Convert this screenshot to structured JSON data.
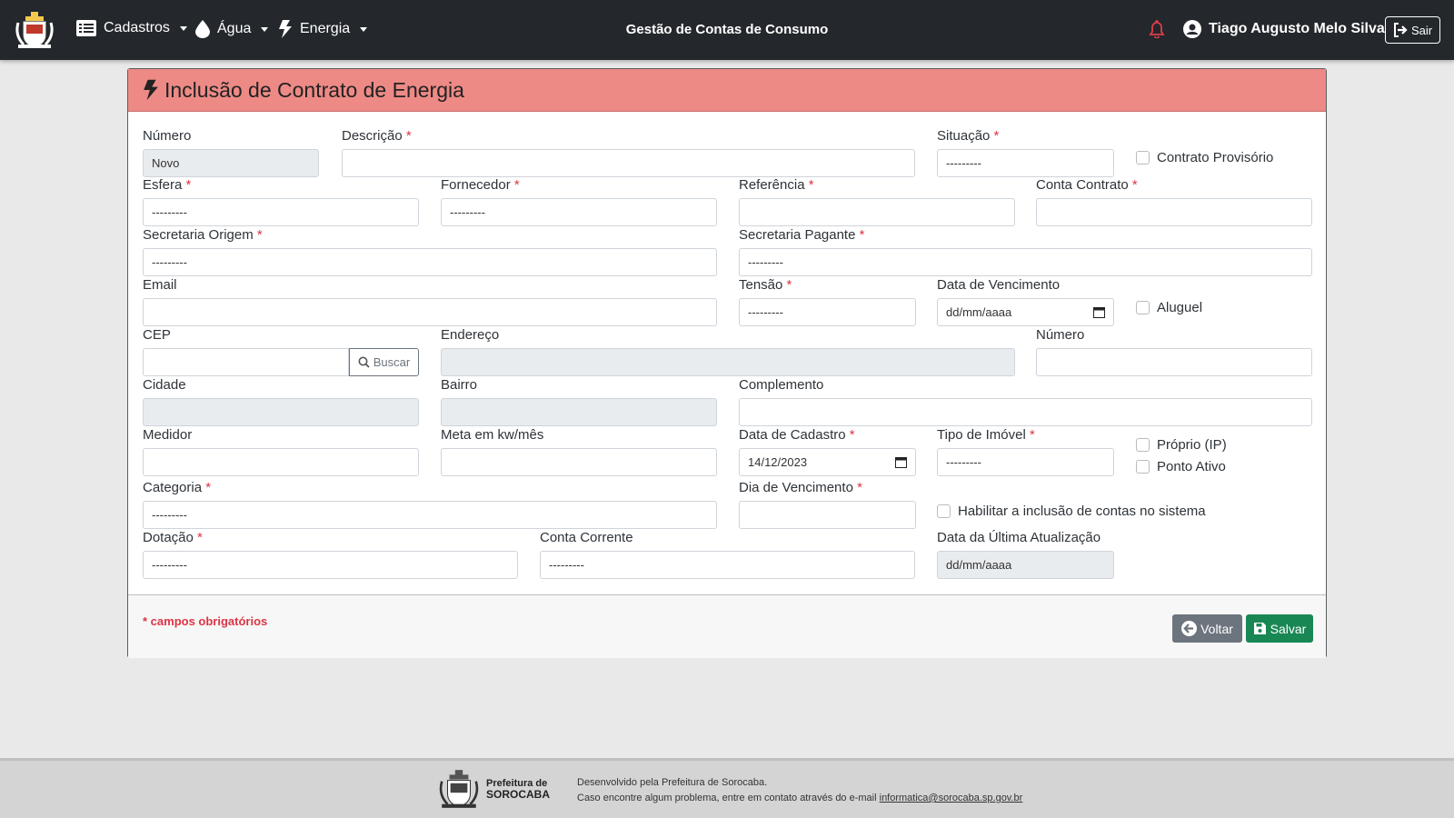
{
  "navbar": {
    "menus": [
      {
        "label": "Cadastros",
        "icon": "list-icon"
      },
      {
        "label": "Água",
        "icon": "droplet-icon"
      },
      {
        "label": "Energia",
        "icon": "bolt-icon"
      }
    ],
    "title": "Gestão de Contas de Consumo",
    "user_name": "Tiago Augusto Melo Silva",
    "logout_label": "Sair"
  },
  "form": {
    "title": "Inclusão de Contrato de Energia",
    "required_marker": "*",
    "fields": {
      "numero": {
        "label": "Número",
        "value": "Novo"
      },
      "descricao": {
        "label": "Descrição",
        "value": ""
      },
      "situacao": {
        "label": "Situação",
        "value": "---------"
      },
      "contrato_provisorio": {
        "label": "Contrato Provisório",
        "checked": false
      },
      "esfera": {
        "label": "Esfera",
        "value": "---------"
      },
      "fornecedor": {
        "label": "Fornecedor",
        "value": "---------"
      },
      "referencia": {
        "label": "Referência",
        "value": ""
      },
      "conta_contrato": {
        "label": "Conta Contrato",
        "value": ""
      },
      "secretaria_origem": {
        "label": "Secretaria Origem",
        "value": "---------"
      },
      "secretaria_pagante": {
        "label": "Secretaria Pagante",
        "value": "---------"
      },
      "email": {
        "label": "Email",
        "value": ""
      },
      "tensao": {
        "label": "Tensão",
        "value": "---------"
      },
      "data_vencimento": {
        "label": "Data de Vencimento",
        "value": "dd/mm/aaaa"
      },
      "aluguel": {
        "label": "Aluguel",
        "checked": false
      },
      "cep": {
        "label": "CEP",
        "value": "",
        "button": "Buscar"
      },
      "endereco": {
        "label": "Endereço",
        "value": ""
      },
      "numero_end": {
        "label": "Número",
        "value": ""
      },
      "cidade": {
        "label": "Cidade",
        "value": ""
      },
      "bairro": {
        "label": "Bairro",
        "value": ""
      },
      "complemento": {
        "label": "Complemento",
        "value": ""
      },
      "medidor": {
        "label": "Medidor",
        "value": ""
      },
      "meta": {
        "label": "Meta em kw/mês",
        "value": ""
      },
      "data_cadastro": {
        "label": "Data de Cadastro",
        "value": "14/12/2023"
      },
      "tipo_imovel": {
        "label": "Tipo de Imóvel",
        "value": "---------"
      },
      "proprio": {
        "label": "Próprio (IP)",
        "checked": false
      },
      "ponto_ativo": {
        "label": "Ponto Ativo",
        "checked": false
      },
      "categoria": {
        "label": "Categoria",
        "value": "---------"
      },
      "dia_vencimento": {
        "label": "Dia de Vencimento",
        "value": ""
      },
      "habilitar": {
        "label": "Habilitar a inclusão de contas no sistema",
        "checked": false
      },
      "dotacao": {
        "label": "Dotação",
        "value": "---------"
      },
      "conta_corrente": {
        "label": "Conta Corrente",
        "value": "---------"
      },
      "ultima_atualizacao": {
        "label": "Data da Última Atualização",
        "value": "dd/mm/aaaa"
      }
    },
    "required_note": "* campos obrigatórios",
    "back_label": "Voltar",
    "save_label": "Salvar"
  },
  "footer": {
    "brand_line1": "Prefeitura de",
    "brand_line2": "SOROCABA",
    "line1": "Desenvolvido pela Prefeitura de Sorocaba.",
    "line2": "Caso encontre algum problema, entre em contato através do e-mail",
    "email": "informatica@sorocaba.sp.gov.br"
  },
  "colors": {
    "navbar": "#24282c",
    "header_accent": "#ed8a86",
    "required": "#dc3545",
    "save": "#198754",
    "back": "#6c757d"
  }
}
